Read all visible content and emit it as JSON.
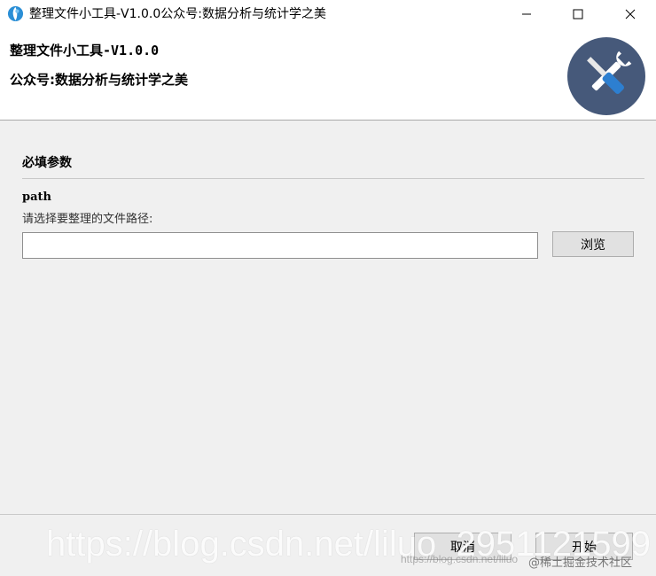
{
  "window": {
    "title": "整理文件小工具-V1.0.0公众号:数据分析与统计学之美",
    "controls": {
      "minimize": "—",
      "maximize": "☐",
      "close": "✕"
    }
  },
  "header": {
    "title": "整理文件小工具-V1.0.0",
    "subtitle": "公众号:数据分析与统计学之美",
    "logo_icon": "wrench-screwdriver-icon",
    "logo_bg": "#46597a"
  },
  "section": {
    "title": "必填参数"
  },
  "path_field": {
    "label": "path",
    "description": "请选择要整理的文件路径:",
    "value": "",
    "browse_label": "浏览"
  },
  "footer": {
    "cancel_label": "取消",
    "start_label": "开始"
  },
  "watermarks": {
    "main": "https://blog.csdn.net/liluo_2951121599",
    "small": "https://blog.csdn.net/liluo",
    "juejin": "@稀土掘金技术社区"
  }
}
